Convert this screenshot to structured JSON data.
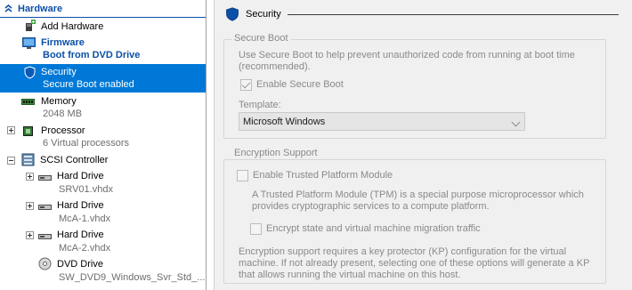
{
  "tree": {
    "category": "Hardware",
    "items": [
      {
        "label": "Add Hardware",
        "sub": ""
      },
      {
        "label": "Firmware",
        "sub": "Boot from DVD Drive"
      },
      {
        "label": "Security",
        "sub": "Secure Boot enabled"
      },
      {
        "label": "Memory",
        "sub": "2048 MB"
      },
      {
        "label": "Processor",
        "sub": "6 Virtual processors"
      },
      {
        "label": "SCSI Controller",
        "sub": ""
      },
      {
        "label": "Hard Drive",
        "sub": "SRV01.vhdx"
      },
      {
        "label": "Hard Drive",
        "sub": "McA-1.vhdx"
      },
      {
        "label": "Hard Drive",
        "sub": "McA-2.vhdx"
      },
      {
        "label": "DVD Drive",
        "sub": "SW_DVD9_Windows_Svr_Std_..."
      }
    ]
  },
  "pane": {
    "title": "Security",
    "secure_boot": {
      "legend": "Secure Boot",
      "description": "Use Secure Boot to help prevent unauthorized code from running at boot time (recommended).",
      "enable_label": "Enable Secure Boot",
      "enable_checked": true,
      "template_label": "Template:",
      "template_value": "Microsoft Windows"
    },
    "encryption": {
      "legend": "Encryption Support",
      "tpm_label": "Enable Trusted Platform Module",
      "tpm_checked": false,
      "tpm_description": "A Trusted Platform Module (TPM) is a special purpose microprocessor which provides cryptographic services to a compute platform.",
      "encrypt_label": "Encrypt state and virtual machine migration traffic",
      "encrypt_checked": false,
      "note": "Encryption support requires a key protector (KP) configuration for the virtual machine. If not already present, selecting one of these options will generate a KP that allows running the virtual machine on this host."
    }
  },
  "colors": {
    "selection": "#0078d7",
    "category": "#0b4fa8",
    "pane_bg": "#f0f0f0",
    "disabled_text": "#8a8a8a"
  }
}
